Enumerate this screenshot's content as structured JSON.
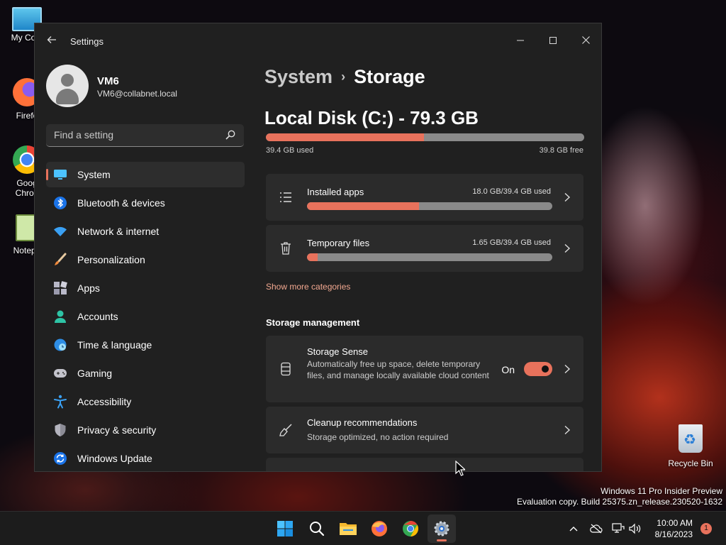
{
  "desktop": {
    "icons": [
      {
        "label": "My Com",
        "icon": "monitor-icon"
      },
      {
        "label": "Firefo",
        "icon": "firefox-icon"
      },
      {
        "label": "Goog",
        "label2": "Chron",
        "icon": "chrome-icon"
      },
      {
        "label": "Notepa",
        "icon": "notepad-icon"
      }
    ],
    "recycle_bin": "Recycle Bin",
    "watermark": {
      "line1": "Windows 11 Pro Insider Preview",
      "line2": "Evaluation copy. Build 25375.zn_release.230520-1632"
    }
  },
  "window": {
    "title": "Settings",
    "controls": {
      "minimize": "—",
      "maximize": "☐",
      "close": "✕"
    }
  },
  "profile": {
    "name": "VM6",
    "email": "VM6@collabnet.local"
  },
  "search": {
    "placeholder": "Find a setting"
  },
  "sidebar": {
    "items": [
      {
        "label": "System",
        "icon": "monitor-icon",
        "active": true
      },
      {
        "label": "Bluetooth & devices",
        "icon": "bluetooth-icon"
      },
      {
        "label": "Network & internet",
        "icon": "wifi-icon"
      },
      {
        "label": "Personalization",
        "icon": "brush-icon"
      },
      {
        "label": "Apps",
        "icon": "apps-icon"
      },
      {
        "label": "Accounts",
        "icon": "person-icon"
      },
      {
        "label": "Time & language",
        "icon": "globe-clock-icon"
      },
      {
        "label": "Gaming",
        "icon": "gamepad-icon"
      },
      {
        "label": "Accessibility",
        "icon": "accessibility-icon"
      },
      {
        "label": "Privacy & security",
        "icon": "shield-icon"
      },
      {
        "label": "Windows Update",
        "icon": "update-icon"
      }
    ]
  },
  "breadcrumb": {
    "parent": "System",
    "separator": "›",
    "current": "Storage"
  },
  "disk": {
    "title": "Local Disk (C:) - 79.3 GB",
    "used_label": "39.4 GB used",
    "free_label": "39.8 GB free",
    "used_fraction": 0.4969
  },
  "categories": {
    "installed_apps": {
      "title": "Installed apps",
      "meta": "18.0 GB/39.4 GB used",
      "fraction": 0.457
    },
    "temporary_files": {
      "title": "Temporary files",
      "meta": "1.65 GB/39.4 GB used",
      "fraction": 0.042
    },
    "show_more": "Show more categories"
  },
  "storage_management": {
    "heading": "Storage management",
    "storage_sense": {
      "title": "Storage Sense",
      "description": "Automatically free up space, delete temporary files, and manage locally available cloud content",
      "toggle_label": "On",
      "toggle_on": true
    },
    "cleanup": {
      "title": "Cleanup recommendations",
      "description": "Storage optimized, no action required"
    }
  },
  "taskbar": {
    "apps": [
      "start-icon",
      "search-icon",
      "file-explorer-icon",
      "firefox-icon",
      "chrome-icon",
      "settings-icon"
    ],
    "time": "10:00 AM",
    "date": "8/16/2023",
    "notifications": "1"
  },
  "colors": {
    "accent": "#e8725c",
    "window_bg": "#202020",
    "card_bg": "#2b2b2b"
  }
}
